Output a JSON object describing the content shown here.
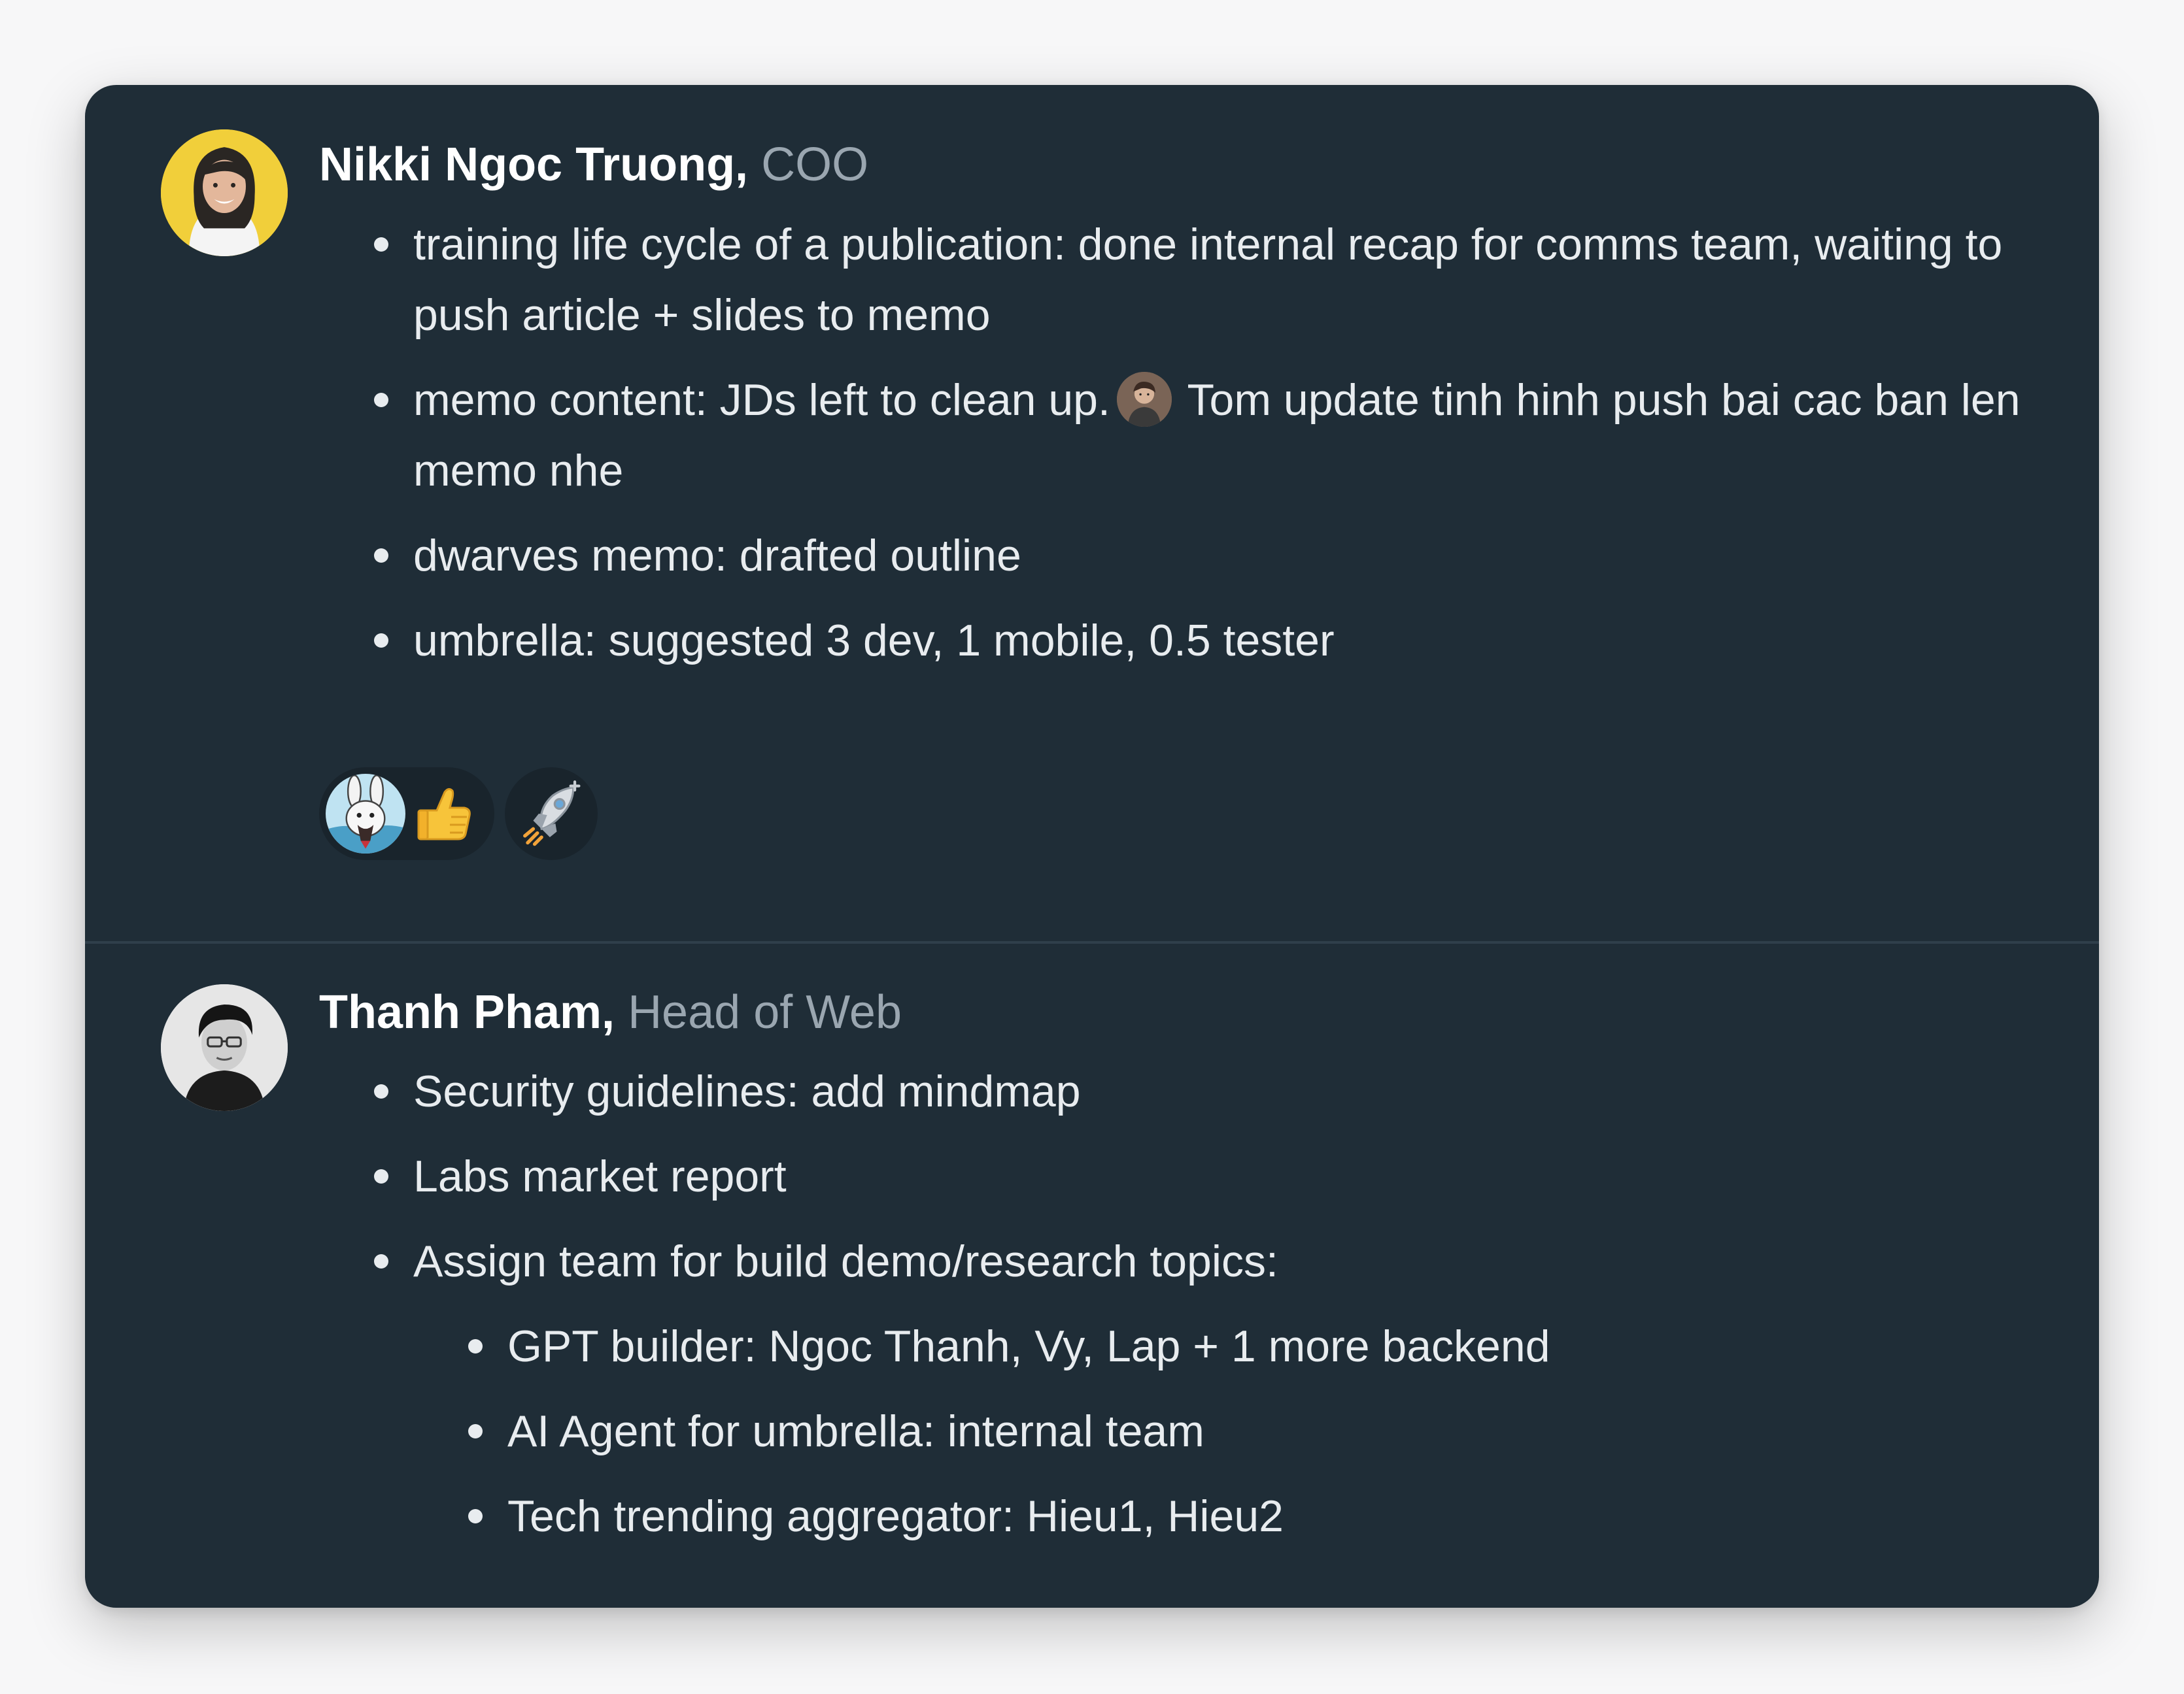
{
  "messages": [
    {
      "author": "Nikki Ngoc Truong,",
      "role": "COO",
      "avatar_icon": "woman-portrait-yellow",
      "bullets": {
        "b0": "training life cycle of a publication: done internal recap for comms team, waiting to push article + slides to memo",
        "b1_before": "memo content: JDs left to clean up.",
        "b1_after": "Tom update tinh hinh push bai cac ban len memo nhe",
        "b2": "dwarves memo: drafted outline",
        "b3": "umbrella: suggested 3 dev, 1 mobile, 0.5 tester"
      },
      "reactions": [
        {
          "icon": "rabbit-avatar",
          "emoji_icon": "thumbs-up-icon"
        },
        {
          "icon": "add-reaction-rocket-icon"
        }
      ]
    },
    {
      "author": "Thanh Pham,",
      "role": "Head of Web",
      "avatar_icon": "man-portrait-bw",
      "bullets": {
        "b0": "Security guidelines: add mindmap",
        "b1": "Labs market report",
        "b2": "Assign team for build demo/research topics:",
        "s0": "GPT builder: Ngoc Thanh, Vy, Lap + 1 more backend",
        "s1": "AI Agent for umbrella: internal team",
        "s2": "Tech trending aggregator: Hieu1, Hieu2"
      }
    }
  ],
  "colors": {
    "card_background": "#1f2d37",
    "page_background": "#f7f7f8",
    "role_text": "#9aa6b0",
    "body_text": "#e8ecef",
    "reaction_pill": "#19242c"
  }
}
